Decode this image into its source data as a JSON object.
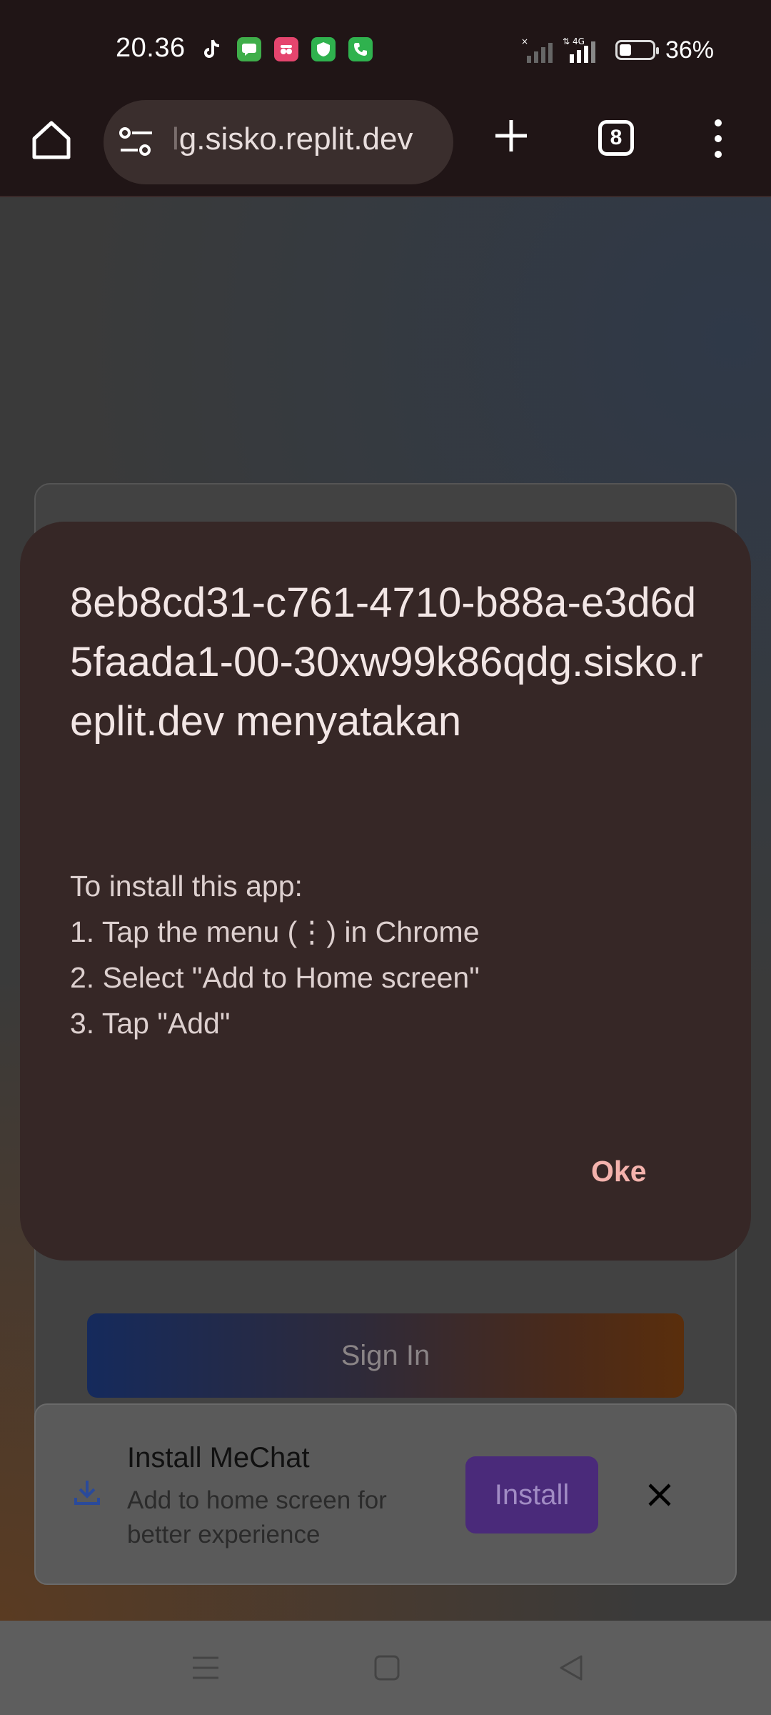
{
  "status_bar": {
    "time": "20.36",
    "battery_percent": "36%",
    "battery_level": 0.36,
    "network": "4G"
  },
  "browser": {
    "url_faded": "l",
    "url": "g.sisko.replit.dev",
    "tab_count": "8"
  },
  "page": {
    "signin_label": "Sign In",
    "install_banner": {
      "title": "Install MeChat",
      "subtitle": "Add to home screen for better experience",
      "install_label": "Install"
    }
  },
  "dialog": {
    "title": "8eb8cd31-c761-4710-b88a-e3d6d5faada1-00-30xw99k86qdg.sisko.replit.dev menyatakan",
    "message": "To install this app:\n1. Tap the menu (⋮) in Chrome\n2. Select \"Add to Home screen\"\n3. Tap \"Add\"",
    "ok_label": "Oke"
  },
  "colors": {
    "dialog_bg": "#362726",
    "ok_accent": "#f4b3ad",
    "install_button": "#4a2a7a"
  }
}
